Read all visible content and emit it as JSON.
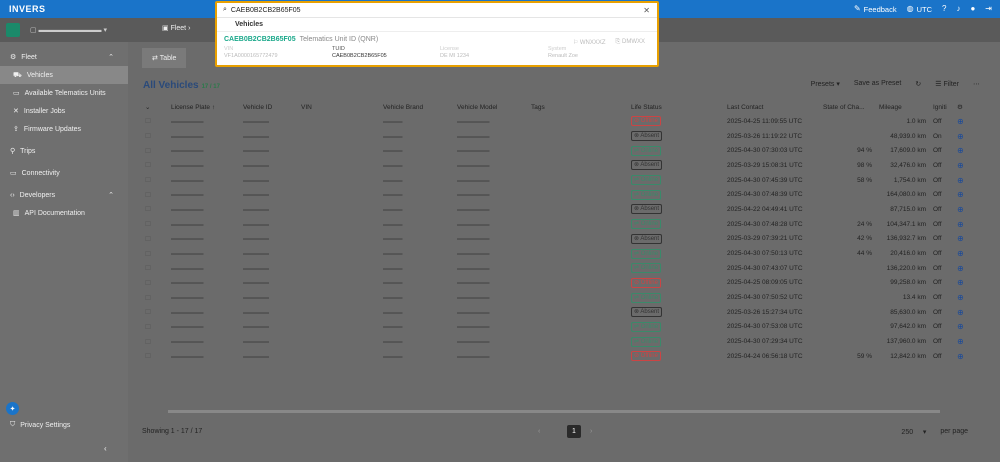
{
  "brand": "INVERS",
  "topbar": {
    "feedback": "Feedback",
    "timezone": "UTC"
  },
  "nav": {
    "fleet": "Fleet",
    "vehicles": "Vehicles",
    "telematics": "Available Telematics Units",
    "installer": "Installer Jobs",
    "firmware": "Firmware Updates",
    "trips": "Trips",
    "connectivity": "Connectivity",
    "developers": "Developers",
    "api": "API Documentation",
    "privacy": "Privacy Settings"
  },
  "breadcrumb": {
    "fleet": "Fleet"
  },
  "tabs": {
    "table": "Table"
  },
  "page": {
    "title": "All Vehicles",
    "count": "17 / 17"
  },
  "toolbar": {
    "presets": "Presets",
    "save": "Save as Preset",
    "filter": "Filter"
  },
  "columns": [
    "License Plate",
    "Vehicle ID",
    "VIN",
    "Vehicle Brand",
    "Vehicle Model",
    "Tags",
    "Life Status",
    "Last Contact",
    "State of Cha...",
    "Mileage",
    "Igniti"
  ],
  "rows": [
    {
      "status": "Offline",
      "contact": "2025-04-25 11:09:55 UTC",
      "soc": "",
      "mileage": "1.0 km",
      "ign": "Off"
    },
    {
      "status": "Absent",
      "contact": "2025-03-26 11:19:22 UTC",
      "soc": "",
      "mileage": "48,939.0 km",
      "ign": "On"
    },
    {
      "status": "Online",
      "contact": "2025-04-30 07:30:03 UTC",
      "soc": "94 %",
      "mileage": "17,609.0 km",
      "ign": "Off"
    },
    {
      "status": "Absent",
      "contact": "2025-03-29 15:08:31 UTC",
      "soc": "98 %",
      "mileage": "32,476.0 km",
      "ign": "Off"
    },
    {
      "status": "Online",
      "contact": "2025-04-30 07:45:39 UTC",
      "soc": "58 %",
      "mileage": "1,754.0 km",
      "ign": "Off"
    },
    {
      "status": "Online",
      "contact": "2025-04-30 07:48:39 UTC",
      "soc": "",
      "mileage": "164,080.0 km",
      "ign": "Off"
    },
    {
      "status": "Absent",
      "contact": "2025-04-22 04:49:41 UTC",
      "soc": "",
      "mileage": "87,715.0 km",
      "ign": "Off"
    },
    {
      "status": "Online",
      "contact": "2025-04-30 07:48:28 UTC",
      "soc": "24 %",
      "mileage": "104,347.1 km",
      "ign": "Off"
    },
    {
      "status": "Absent",
      "contact": "2025-03-29 07:39:21 UTC",
      "soc": "42 %",
      "mileage": "136,932.7 km",
      "ign": "Off"
    },
    {
      "status": "Online",
      "contact": "2025-04-30 07:50:13 UTC",
      "soc": "44 %",
      "mileage": "20,416.0 km",
      "ign": "Off"
    },
    {
      "status": "Online",
      "contact": "2025-04-30 07:43:07 UTC",
      "soc": "",
      "mileage": "136,220.0 km",
      "ign": "Off"
    },
    {
      "status": "Offline",
      "contact": "2025-04-25 08:09:05 UTC",
      "soc": "",
      "mileage": "99,258.0 km",
      "ign": "Off"
    },
    {
      "status": "Online",
      "contact": "2025-04-30 07:50:52 UTC",
      "soc": "",
      "mileage": "13.4 km",
      "ign": "Off"
    },
    {
      "status": "Absent",
      "contact": "2025-03-26 15:27:34 UTC",
      "soc": "",
      "mileage": "85,630.0 km",
      "ign": "Off"
    },
    {
      "status": "Online",
      "contact": "2025-04-30 07:53:08 UTC",
      "soc": "",
      "mileage": "97,642.0 km",
      "ign": "Off"
    },
    {
      "status": "Online",
      "contact": "2025-04-30 07:29:34 UTC",
      "soc": "",
      "mileage": "137,960.0 km",
      "ign": "Off"
    },
    {
      "status": "Offline",
      "contact": "2025-04-24 06:56:18 UTC",
      "soc": "59 %",
      "mileage": "12,842.0 km",
      "ign": "Off"
    }
  ],
  "footer": {
    "showing": "Showing  1 - 17 / 17",
    "page": "1",
    "per_page_value": "250",
    "per_page_label": "per page"
  },
  "search": {
    "query": "CAEB0B2CB2B65F05",
    "group": "Vehicles",
    "result_id": "CAEB0B2CB2B65F05",
    "result_type": "Telematics Unit ID (QNR)",
    "right_a": "WNXXXZ",
    "right_b": "DMWXX",
    "fields": [
      {
        "label": "VIN",
        "value": "VF1A0000165772479",
        "hl": false
      },
      {
        "label": "TUID",
        "value": "CAEB0B2CB2B65F05",
        "hl": true
      },
      {
        "label": "License",
        "value": "DE MI 1234",
        "hl": false
      },
      {
        "label": "System",
        "value": "Renault Zoe",
        "hl": false
      }
    ]
  }
}
